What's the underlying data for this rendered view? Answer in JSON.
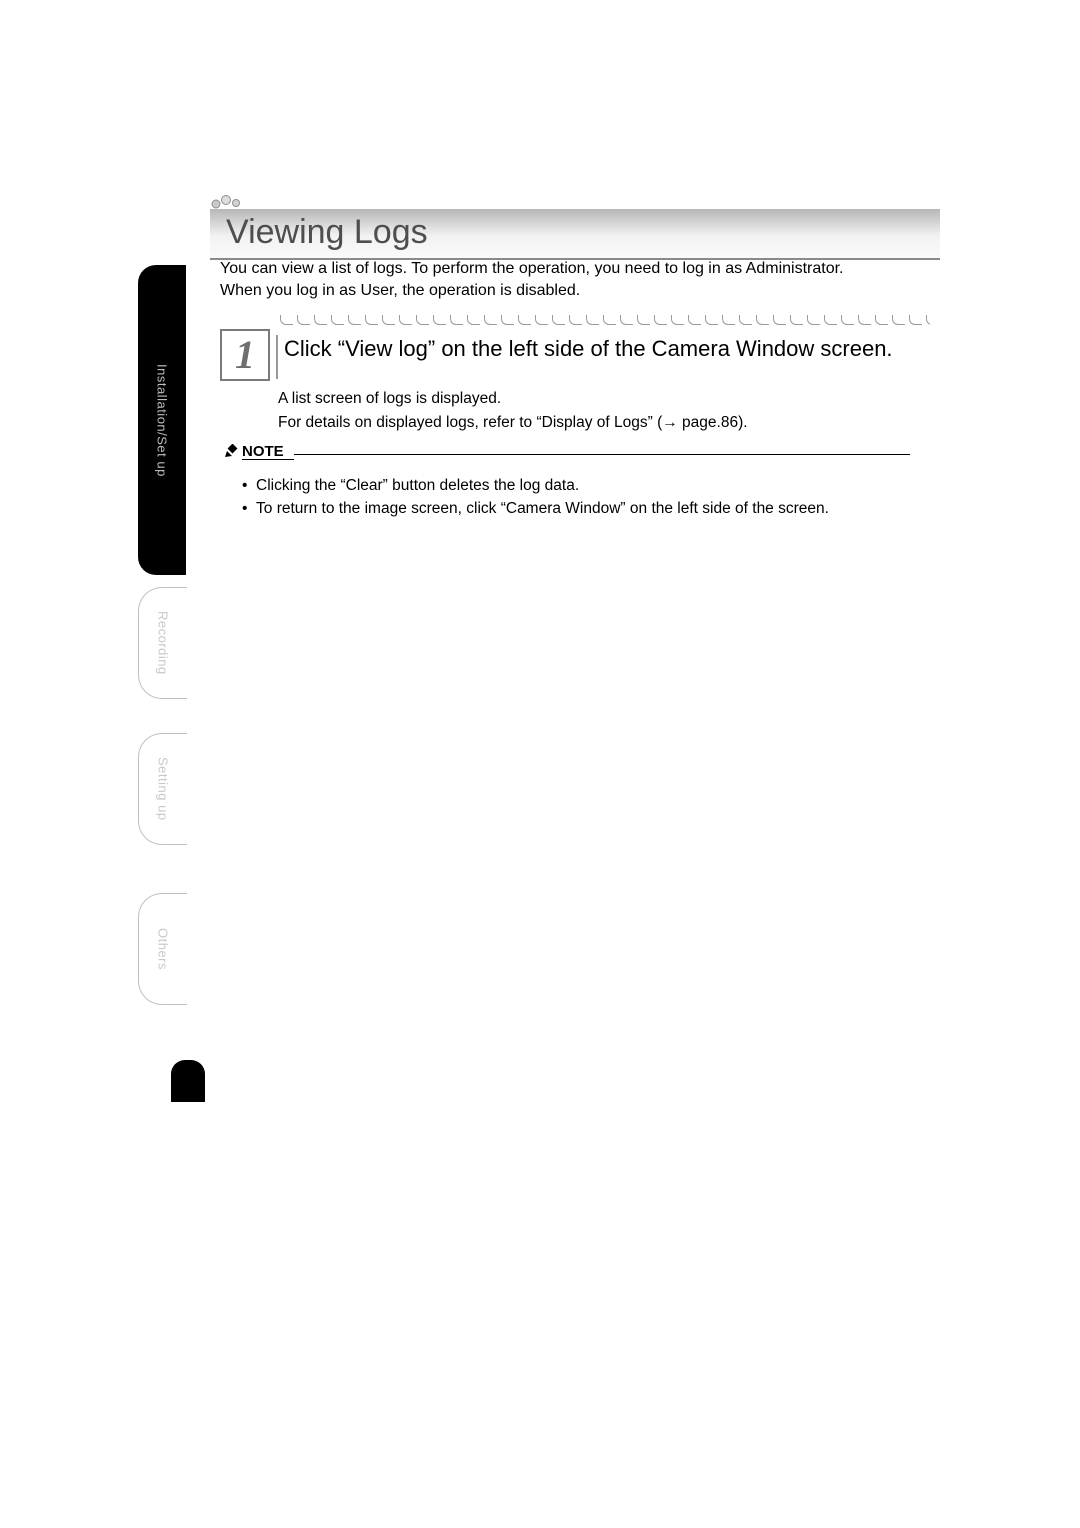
{
  "title": "Viewing Logs",
  "intro_line1": "You can view a list of logs. To perform the operation, you need to log in as Administrator.",
  "intro_line2": "When you log in as User, the operation is disabled.",
  "step": {
    "number": "1",
    "text_prefix": "Click “",
    "text_em": "View log",
    "text_suffix": "” on the left side of the Camera Window screen.",
    "body_line1": "A list screen of logs is displayed.",
    "body_line2a": "For details on displayed logs, refer to “Display of Logs” (",
    "body_line2_arrow": "→",
    "body_line2b": " page.86)."
  },
  "note": {
    "label": "NOTE",
    "items": [
      "Clicking the “Clear” button deletes the log data.",
      "To return to the image screen, click “Camera Window” on the left side of the screen."
    ]
  },
  "side_tabs": {
    "active": "Installation/Set up",
    "recording": "Recording",
    "setting": "Setting up",
    "others": "Others"
  },
  "page_number": ""
}
